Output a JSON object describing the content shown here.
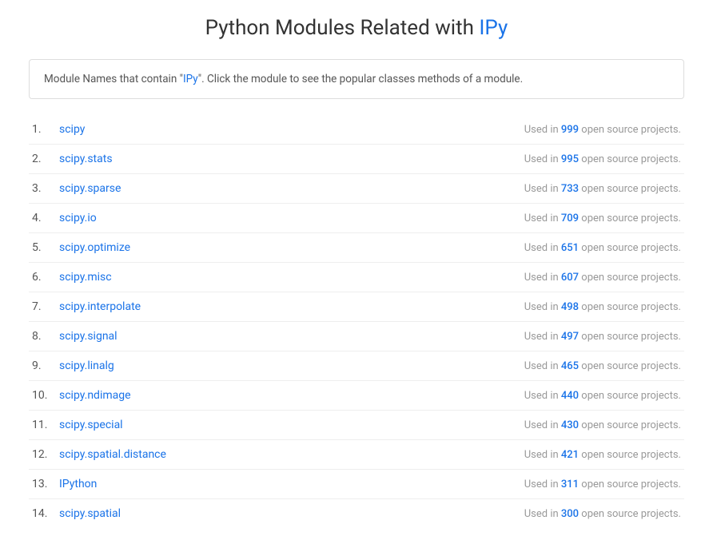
{
  "header": {
    "title_prefix": "Python Modules Related with ",
    "title_highlight": "IPy"
  },
  "info_box": {
    "text_prefix": "Module Names that contain \"",
    "text_highlight": "IPy",
    "text_suffix": "\". Click the module to see the popular classes methods of a module."
  },
  "modules": [
    {
      "number": "1.",
      "name": "scipy",
      "count": "999"
    },
    {
      "number": "2.",
      "name": "scipy.stats",
      "count": "995"
    },
    {
      "number": "3.",
      "name": "scipy.sparse",
      "count": "733"
    },
    {
      "number": "4.",
      "name": "scipy.io",
      "count": "709"
    },
    {
      "number": "5.",
      "name": "scipy.optimize",
      "count": "651"
    },
    {
      "number": "6.",
      "name": "scipy.misc",
      "count": "607"
    },
    {
      "number": "7.",
      "name": "scipy.interpolate",
      "count": "498"
    },
    {
      "number": "8.",
      "name": "scipy.signal",
      "count": "497"
    },
    {
      "number": "9.",
      "name": "scipy.linalg",
      "count": "465"
    },
    {
      "number": "10.",
      "name": "scipy.ndimage",
      "count": "440"
    },
    {
      "number": "11.",
      "name": "scipy.special",
      "count": "430"
    },
    {
      "number": "12.",
      "name": "scipy.spatial.distance",
      "count": "421"
    },
    {
      "number": "13.",
      "name": "IPython",
      "count": "311"
    },
    {
      "number": "14.",
      "name": "scipy.spatial",
      "count": "300"
    }
  ],
  "usage_text": {
    "prefix": "Used in ",
    "suffix": " open source projects."
  }
}
